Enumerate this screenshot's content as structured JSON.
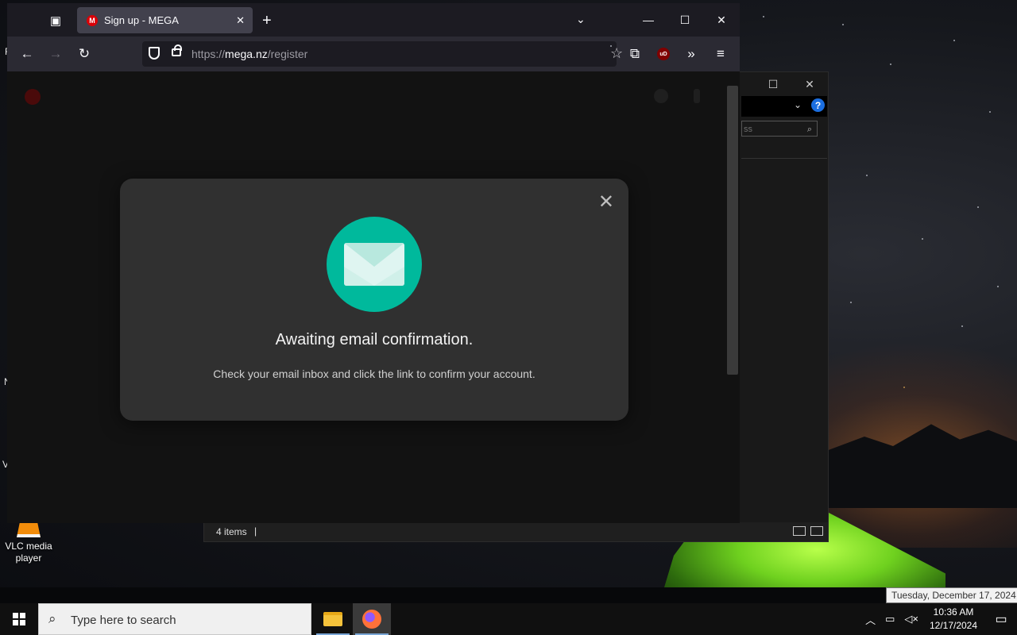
{
  "desktop": {
    "edge_chars": [
      "F",
      "N",
      "V"
    ],
    "icons": [
      {
        "label": "VLC media player"
      }
    ]
  },
  "explorer": {
    "search_placeholder": "ss",
    "status": {
      "items_count": "4 items"
    }
  },
  "browser": {
    "tab": {
      "title": "Sign up - MEGA",
      "favicon_letter": "M"
    },
    "url_prefix": "https://",
    "url_host": "mega.nz",
    "url_path": "/register",
    "extension_badge": "uD"
  },
  "modal": {
    "title": "Awaiting email confirmation.",
    "message": "Check your email inbox and click the link to confirm your account."
  },
  "taskbar": {
    "search_placeholder": "Type here to search",
    "time": "10:36 AM",
    "date": "12/17/2024",
    "tooltip": "Tuesday, December 17, 2024"
  },
  "colors": {
    "mega_red": "#d90007",
    "envelope_teal": "#00b99c",
    "modal_bg": "#303030",
    "firefox_toolbar": "#2b2a33"
  }
}
